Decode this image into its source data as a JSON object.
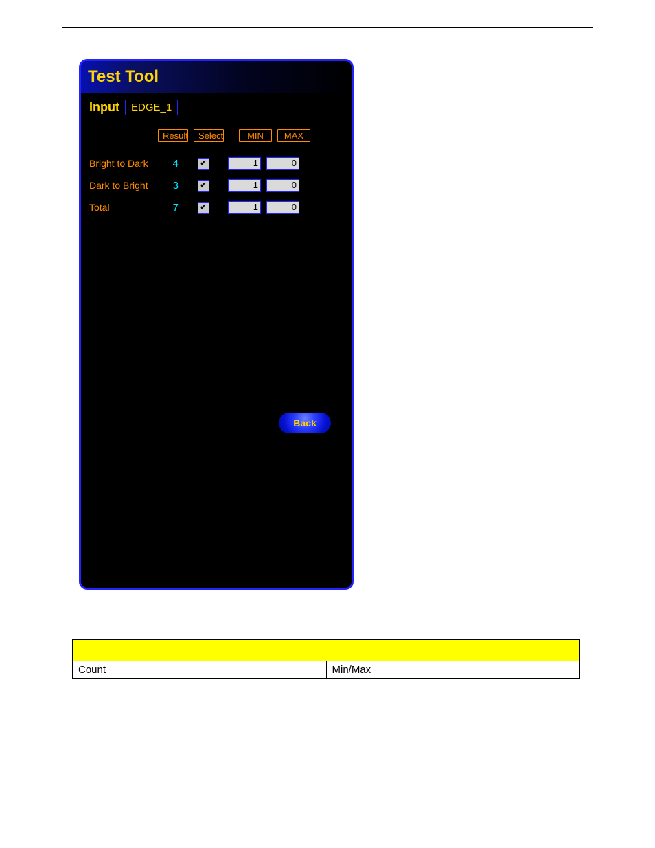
{
  "titlebar": {
    "title": "Test Tool"
  },
  "subbar": {
    "label": "Input",
    "value": "EDGE_1"
  },
  "headers": {
    "result": "Result",
    "select": "Select",
    "min": "MIN",
    "max": "MAX"
  },
  "rows": [
    {
      "label": "Bright to Dark",
      "result": "4",
      "checked": true,
      "min": "1",
      "max": "0"
    },
    {
      "label": "Dark to Bright",
      "result": "3",
      "checked": true,
      "min": "1",
      "max": "0"
    },
    {
      "label": "Total",
      "result": "7",
      "checked": true,
      "min": "1",
      "max": "0"
    }
  ],
  "back_label": "Back",
  "note": {
    "col1": "Count",
    "col2": "Min/Max"
  }
}
